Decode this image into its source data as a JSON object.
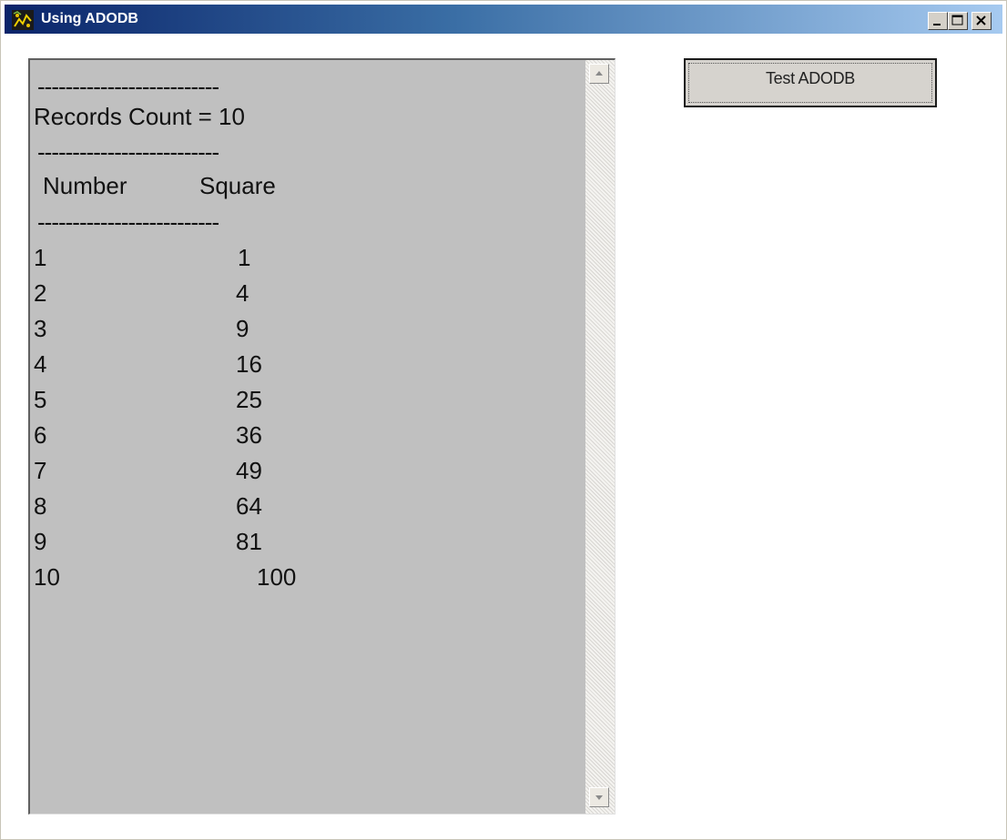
{
  "window": {
    "title": "Using ADODB",
    "buttons": [
      "minimize",
      "maximize",
      "close"
    ]
  },
  "output": {
    "separator": "--------------------------",
    "records_count_line": "Records Count = 10",
    "header_number": "Number",
    "header_square": "Square",
    "rows": [
      {
        "number": "1",
        "square": "1"
      },
      {
        "number": "2",
        "square": "4"
      },
      {
        "number": "3",
        "square": "9"
      },
      {
        "number": "4",
        "square": "16"
      },
      {
        "number": "5",
        "square": "25"
      },
      {
        "number": "6",
        "square": "36"
      },
      {
        "number": "7",
        "square": "49"
      },
      {
        "number": "8",
        "square": "64"
      },
      {
        "number": "9",
        "square": "81"
      },
      {
        "number": "10",
        "square": "100"
      }
    ]
  },
  "toolbar": {
    "test_button_label": "Test ADODB"
  },
  "colors": {
    "titlebar_start": "#0a246a",
    "titlebar_end": "#a6caf0",
    "textarea_bg": "#c0c0c0",
    "button_face": "#d6d3ce"
  },
  "icons": {
    "app": "app-icon",
    "minimize": "minimize-icon",
    "maximize": "maximize-icon",
    "close": "close-icon",
    "scroll_up": "scroll-up-arrow-icon",
    "scroll_down": "scroll-down-arrow-icon"
  }
}
